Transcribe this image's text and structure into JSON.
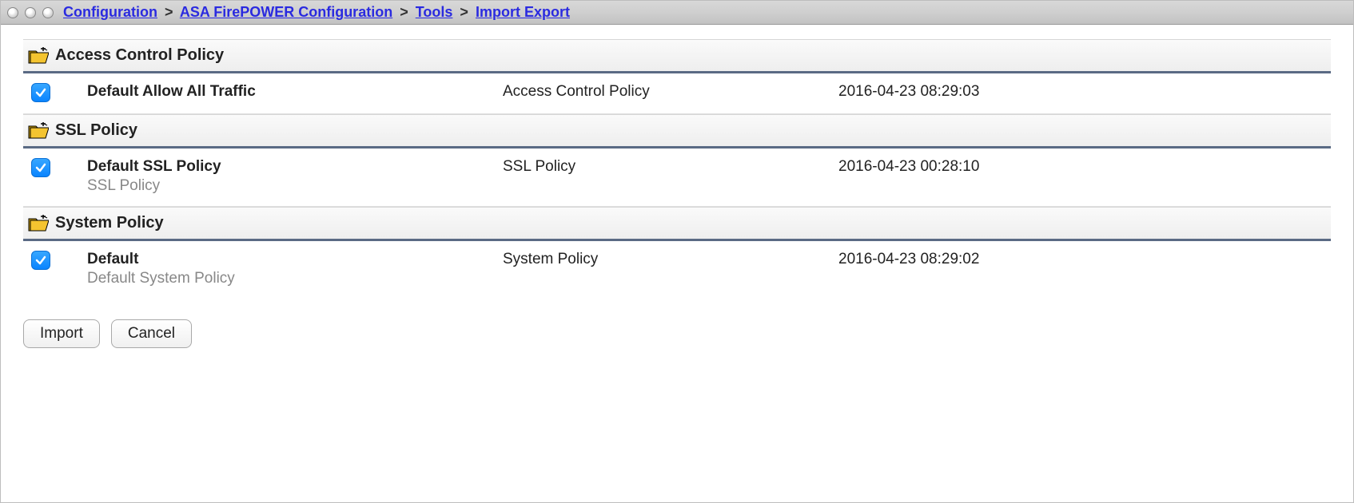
{
  "breadcrumb": {
    "parts": [
      {
        "label": "Configuration",
        "link": true
      },
      {
        "label": "ASA FirePOWER Configuration",
        "link": true
      },
      {
        "label": "Tools",
        "link": true
      },
      {
        "label": "Import Export",
        "link": true
      }
    ],
    "sep": ">"
  },
  "sections": [
    {
      "title": "Access Control Policy",
      "rows": [
        {
          "checked": true,
          "name": "Default Allow All Traffic",
          "subtitle": "",
          "type": "Access Control Policy",
          "date": "2016-04-23 08:29:03"
        }
      ]
    },
    {
      "title": "SSL Policy",
      "rows": [
        {
          "checked": true,
          "name": "Default SSL Policy",
          "subtitle": "SSL Policy",
          "type": "SSL Policy",
          "date": "2016-04-23 00:28:10"
        }
      ]
    },
    {
      "title": "System Policy",
      "rows": [
        {
          "checked": true,
          "name": "Default",
          "subtitle": "Default System Policy",
          "type": "System Policy",
          "date": "2016-04-23 08:29:02"
        }
      ]
    }
  ],
  "buttons": {
    "import": "Import",
    "cancel": "Cancel"
  }
}
